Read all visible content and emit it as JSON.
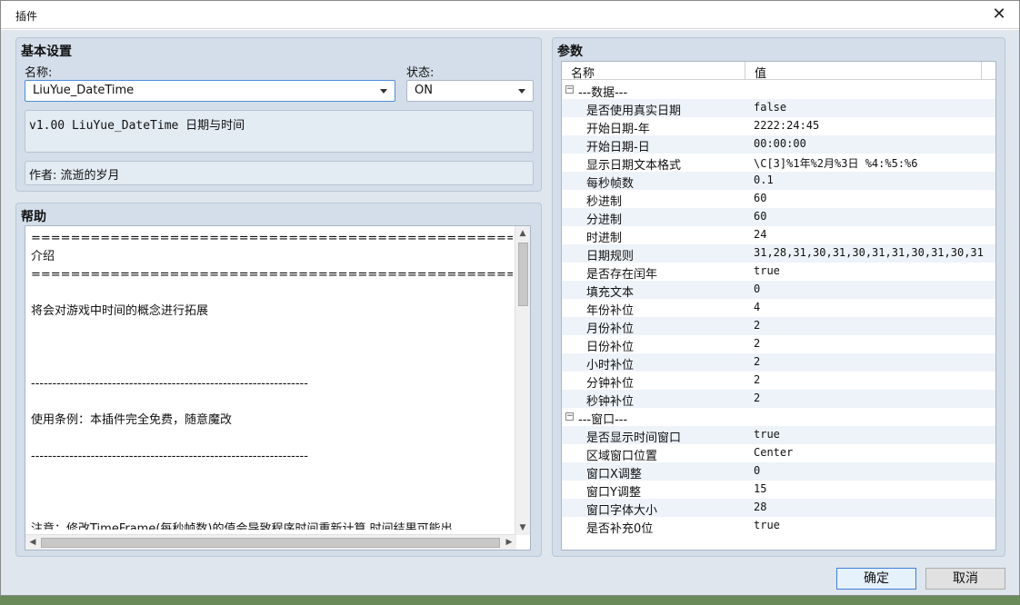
{
  "window": {
    "title": "插件",
    "close_glyph": "✕"
  },
  "basic": {
    "title": "基本设置",
    "name_label": "名称:",
    "name_value": "LiuYue_DateTime",
    "status_label": "状态:",
    "status_value": "ON",
    "description": "v1.00 LiuYue_DateTime 日期与时间",
    "author": "作者: 流逝的岁月"
  },
  "help": {
    "title": "帮助",
    "lines": [
      "==========================================================================",
      "介绍",
      "==========================================================================",
      "",
      "将会对游戏中时间的概念进行拓展",
      "",
      "",
      "",
      "-----------------------------------------------------------------",
      "",
      "使用条例：本插件完全免费，随意魔改",
      "",
      "-----------------------------------------------------------------",
      "",
      "",
      "",
      "注意：修改TimeFrame(每秒帧数)的值会导致程序时间重新计算,时间结果可能出"
    ]
  },
  "params": {
    "title": "参数",
    "col_name": "名称",
    "col_value": "值",
    "rows": [
      {
        "type": "group",
        "name": "---数据---",
        "toggle": "−"
      },
      {
        "type": "item",
        "name": "是否使用真实日期",
        "value": "false"
      },
      {
        "type": "item",
        "name": "开始日期-年",
        "value": "2222:24:45"
      },
      {
        "type": "item",
        "name": "开始日期-日",
        "value": "00:00:00"
      },
      {
        "type": "item",
        "name": "显示日期文本格式",
        "value": "\\C[3]%1年%2月%3日 %4:%5:%6"
      },
      {
        "type": "item",
        "name": "每秒帧数",
        "value": "0.1"
      },
      {
        "type": "item",
        "name": "秒进制",
        "value": "60"
      },
      {
        "type": "item",
        "name": "分进制",
        "value": "60"
      },
      {
        "type": "item",
        "name": "时进制",
        "value": "24"
      },
      {
        "type": "item",
        "name": "日期规则",
        "value": "31,28,31,30,31,30,31,31,30,31,30,31"
      },
      {
        "type": "item",
        "name": "是否存在闰年",
        "value": "true"
      },
      {
        "type": "item",
        "name": "填充文本",
        "value": "0"
      },
      {
        "type": "item",
        "name": "年份补位",
        "value": "4"
      },
      {
        "type": "item",
        "name": "月份补位",
        "value": "2"
      },
      {
        "type": "item",
        "name": "日份补位",
        "value": "2"
      },
      {
        "type": "item",
        "name": "小时补位",
        "value": "2"
      },
      {
        "type": "item",
        "name": "分钟补位",
        "value": "2"
      },
      {
        "type": "item",
        "name": "秒钟补位",
        "value": "2"
      },
      {
        "type": "group",
        "name": "---窗口---",
        "toggle": "−"
      },
      {
        "type": "item",
        "name": "是否显示时间窗口",
        "value": "true"
      },
      {
        "type": "item",
        "name": "区域窗口位置",
        "value": "Center"
      },
      {
        "type": "item",
        "name": "窗口X调整",
        "value": "0"
      },
      {
        "type": "item",
        "name": "窗口Y调整",
        "value": "15"
      },
      {
        "type": "item",
        "name": "窗口字体大小",
        "value": "28"
      },
      {
        "type": "item",
        "name": "是否补充0位",
        "value": "true"
      }
    ]
  },
  "buttons": {
    "ok": "确定",
    "cancel": "取消"
  },
  "colors": {
    "accent": "#3c7fd8",
    "group_bg": "#d3deea",
    "alt_row": "#eef3f9"
  }
}
